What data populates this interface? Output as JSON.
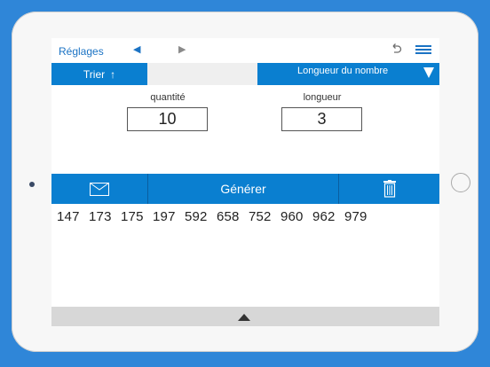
{
  "topbar": {
    "settings_label": "Réglages",
    "prev_icon": "triangle-left-icon",
    "next_icon": "triangle-right-icon",
    "undo_icon": "undo-icon",
    "menu_icon": "hamburger-menu-icon"
  },
  "sort": {
    "label": "Trier",
    "arrow": "↑",
    "length_label": "Longueur du nombre",
    "dropdown_icon": "triangle-down-icon"
  },
  "fields": {
    "quantity_label": "quantité",
    "quantity_value": "10",
    "length_label": "longueur",
    "length_value": "3"
  },
  "actions": {
    "mail_icon": "mail-icon",
    "generate_label": "Générer",
    "trash_icon": "trash-icon"
  },
  "results": {
    "numbers": "147 173 175 197 592 658 752 960 962 979"
  },
  "bottom": {
    "expand_icon": "triangle-up-icon"
  },
  "colors": {
    "background": "#2f86d8",
    "accent": "#0a7fd0",
    "link": "#1b73c4"
  }
}
